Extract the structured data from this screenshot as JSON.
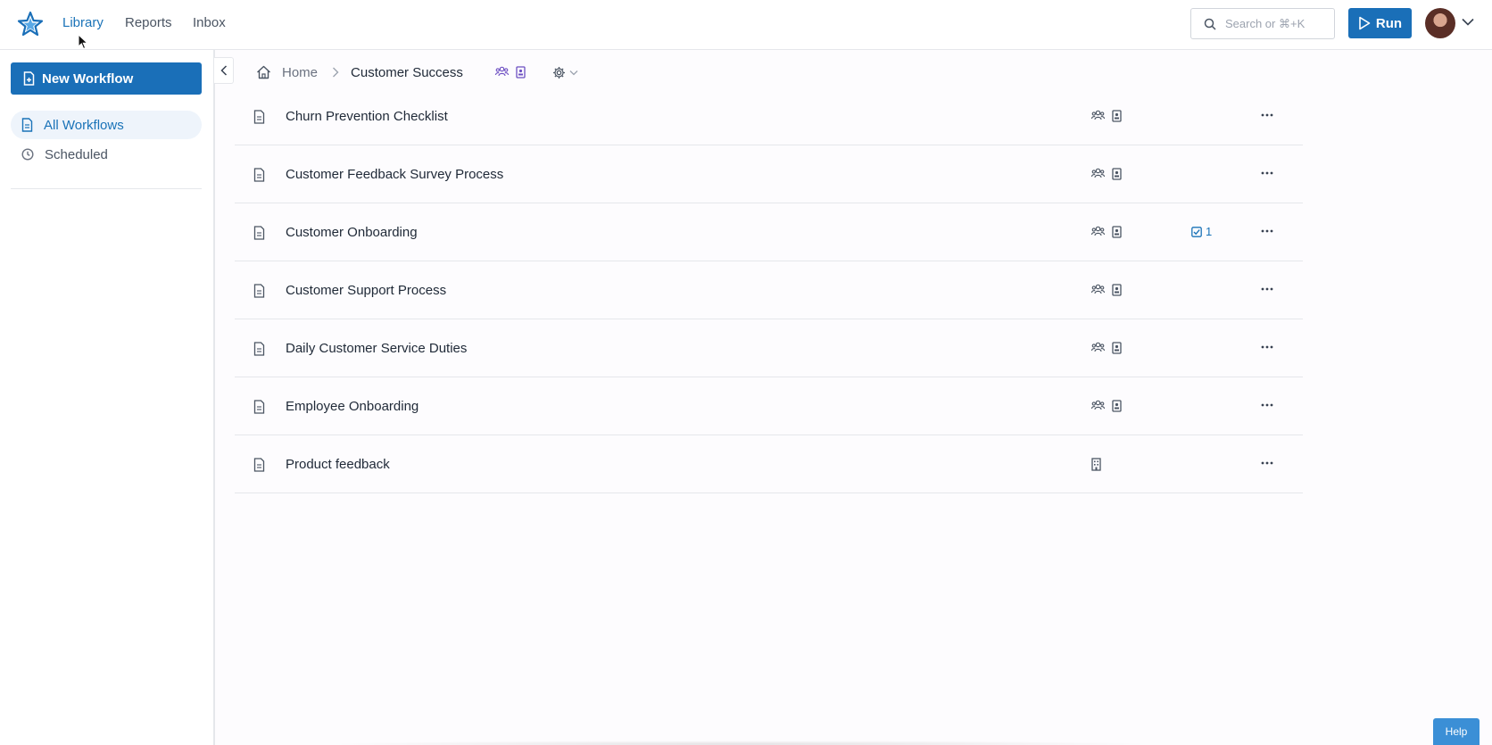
{
  "colors": {
    "accent": "#1a6fb8",
    "accent_text": "#1a73b8",
    "help": "#3b8fd6",
    "purple_icon": "#6d4fc2"
  },
  "topnav": {
    "items": [
      {
        "label": "Library",
        "active": true
      },
      {
        "label": "Reports",
        "active": false
      },
      {
        "label": "Inbox",
        "active": false
      }
    ],
    "search_placeholder": "Search or ⌘+K",
    "run_label": "Run"
  },
  "sidebar": {
    "new_workflow_label": "New Workflow",
    "items": [
      {
        "label": "All Workflows",
        "icon": "document-icon",
        "active": true
      },
      {
        "label": "Scheduled",
        "icon": "clock-icon",
        "active": false
      }
    ]
  },
  "breadcrumb": {
    "home": "Home",
    "current": "Customer Success"
  },
  "workflows": [
    {
      "title": "Churn Prevention Checklist",
      "icons": [
        "team-icon",
        "badge-icon"
      ],
      "badge": ""
    },
    {
      "title": "Customer Feedback Survey Process",
      "icons": [
        "team-icon",
        "badge-icon"
      ],
      "badge": ""
    },
    {
      "title": "Customer Onboarding",
      "icons": [
        "team-icon",
        "badge-icon"
      ],
      "badge": "1"
    },
    {
      "title": "Customer Support Process",
      "icons": [
        "team-icon",
        "badge-icon"
      ],
      "badge": ""
    },
    {
      "title": "Daily Customer Service Duties",
      "icons": [
        "team-icon",
        "badge-icon"
      ],
      "badge": ""
    },
    {
      "title": "Employee Onboarding",
      "icons": [
        "team-icon",
        "badge-icon"
      ],
      "badge": ""
    },
    {
      "title": "Product feedback",
      "icons": [
        "building-icon"
      ],
      "badge": ""
    }
  ],
  "help_label": "Help"
}
